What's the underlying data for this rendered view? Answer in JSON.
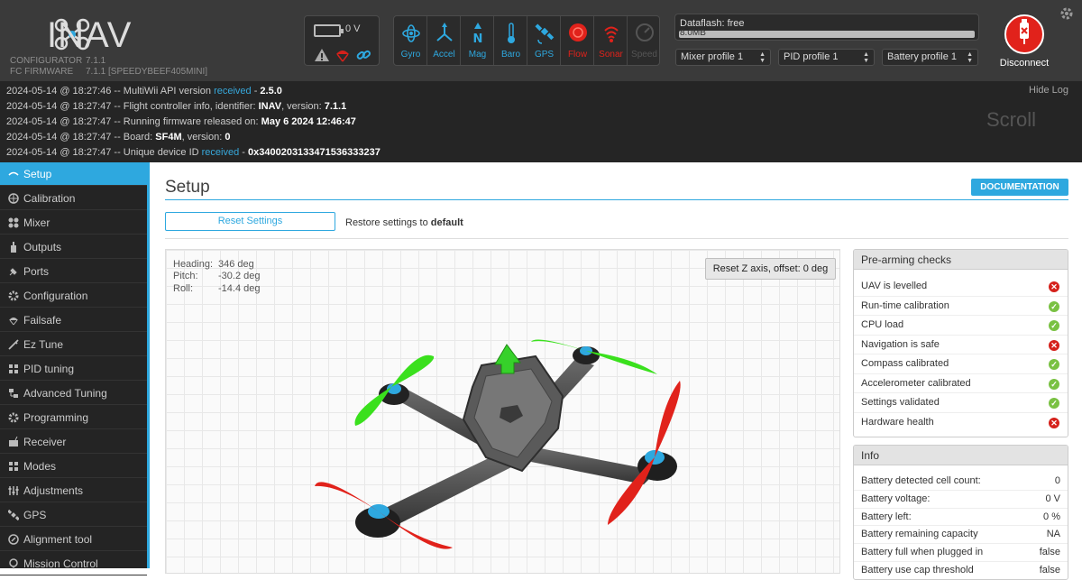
{
  "header": {
    "app_name": "INAV",
    "configurator_label": "CONFIGURATOR",
    "configurator_version": "7.1.1",
    "firmware_label": "FC FIRMWARE",
    "firmware_version": "7.1.1 [SPEEDYBEEF405MINI]",
    "battery_voltage": "0 V",
    "sensors": [
      {
        "name": "Gyro",
        "state": "ok"
      },
      {
        "name": "Accel",
        "state": "ok"
      },
      {
        "name": "Mag",
        "state": "ok"
      },
      {
        "name": "Baro",
        "state": "ok"
      },
      {
        "name": "GPS",
        "state": "ok"
      },
      {
        "name": "Flow",
        "state": "error"
      },
      {
        "name": "Sonar",
        "state": "error"
      },
      {
        "name": "Speed",
        "state": "off"
      }
    ],
    "dataflash_title": "Dataflash: free",
    "dataflash_size": "8.0MB",
    "mixer_profile": "Mixer profile 1",
    "pid_profile": "PID profile 1",
    "battery_profile": "Battery profile 1",
    "disconnect_label": "Disconnect"
  },
  "log": {
    "hide_label": "Hide Log",
    "scroll_label": "Scroll",
    "lines": [
      {
        "prefix": "2024-05-14 @ 18:27:46 -- MultiWii API version ",
        "highlight": "received",
        "mid": " - ",
        "bold": "2.5.0"
      },
      {
        "prefix": "2024-05-14 @ 18:27:47 -- Flight controller info, identifier: ",
        "highlight": "",
        "mid": "",
        "bold": "INAV",
        "suffix": ", version: ",
        "bold2": "7.1.1"
      },
      {
        "prefix": "2024-05-14 @ 18:27:47 -- Running firmware released on: ",
        "highlight": "",
        "mid": "",
        "bold": "May 6 2024 12:46:47"
      },
      {
        "prefix": "2024-05-14 @ 18:27:47 -- Board: ",
        "highlight": "",
        "mid": "",
        "bold": "SF4M",
        "suffix": ", version: ",
        "bold2": "0"
      },
      {
        "prefix": "2024-05-14 @ 18:27:47 -- Unique device ID ",
        "highlight": "received",
        "mid": " - ",
        "bold": "0x3400203133471536333237"
      }
    ]
  },
  "sidebar": {
    "items": [
      {
        "label": "Setup",
        "icon": "setup-icon",
        "active": true
      },
      {
        "label": "Calibration",
        "icon": "calibration-icon"
      },
      {
        "label": "Mixer",
        "icon": "mixer-icon"
      },
      {
        "label": "Outputs",
        "icon": "outputs-icon"
      },
      {
        "label": "Ports",
        "icon": "ports-icon"
      },
      {
        "label": "Configuration",
        "icon": "configuration-icon"
      },
      {
        "label": "Failsafe",
        "icon": "failsafe-icon"
      },
      {
        "label": "Ez Tune",
        "icon": "eztune-icon"
      },
      {
        "label": "PID tuning",
        "icon": "pid-icon"
      },
      {
        "label": "Advanced Tuning",
        "icon": "advanced-tuning-icon"
      },
      {
        "label": "Programming",
        "icon": "programming-icon"
      },
      {
        "label": "Receiver",
        "icon": "receiver-icon"
      },
      {
        "label": "Modes",
        "icon": "modes-icon"
      },
      {
        "label": "Adjustments",
        "icon": "adjustments-icon"
      },
      {
        "label": "GPS",
        "icon": "gps-icon"
      },
      {
        "label": "Alignment tool",
        "icon": "alignment-icon"
      },
      {
        "label": "Mission Control",
        "icon": "mission-icon"
      }
    ]
  },
  "main": {
    "title": "Setup",
    "documentation_label": "DOCUMENTATION",
    "reset_label": "Reset Settings",
    "restore_text": "Restore settings to ",
    "restore_bold": "default",
    "attitude": {
      "heading_label": "Heading:",
      "heading": "346 deg",
      "pitch_label": "Pitch:",
      "pitch": "-30.2 deg",
      "roll_label": "Roll:",
      "roll": "-14.4 deg"
    },
    "reset_z_label": "Reset Z axis, offset: 0 deg"
  },
  "prearming": {
    "title": "Pre-arming checks",
    "checks": [
      {
        "label": "UAV is levelled",
        "ok": false
      },
      {
        "label": "Run-time calibration",
        "ok": true
      },
      {
        "label": "CPU load",
        "ok": true
      },
      {
        "label": "Navigation is safe",
        "ok": false
      },
      {
        "label": "Compass calibrated",
        "ok": true
      },
      {
        "label": "Accelerometer calibrated",
        "ok": true
      },
      {
        "label": "Settings validated",
        "ok": true
      },
      {
        "label": "Hardware health",
        "ok": false
      }
    ]
  },
  "info": {
    "title": "Info",
    "rows": [
      {
        "label": "Battery detected cell count:",
        "value": "0"
      },
      {
        "label": "Battery voltage:",
        "value": "0 V"
      },
      {
        "label": "Battery left:",
        "value": "0 %"
      },
      {
        "label": "Battery remaining capacity",
        "value": "NA"
      },
      {
        "label": "Battery full when plugged in",
        "value": "false"
      },
      {
        "label": "Battery use cap threshold",
        "value": "false"
      }
    ]
  },
  "colors": {
    "accent": "#2ea8df",
    "sensor_ok": "#2ea8df",
    "sensor_error": "#e1221b",
    "ok": "#7ac143",
    "bad": "#d5211b"
  }
}
